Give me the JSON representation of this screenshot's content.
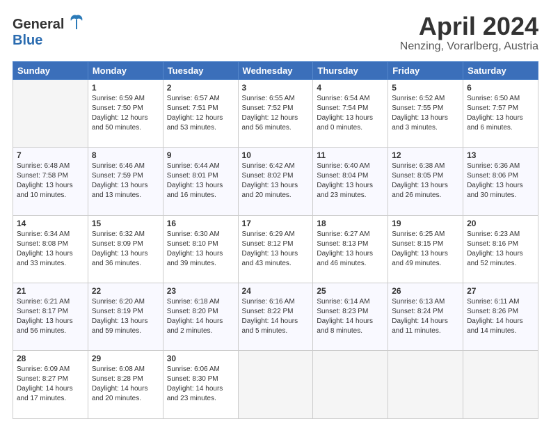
{
  "header": {
    "logo_line1": "General",
    "logo_line2": "Blue",
    "title": "April 2024",
    "subtitle": "Nenzing, Vorarlberg, Austria"
  },
  "weekdays": [
    "Sunday",
    "Monday",
    "Tuesday",
    "Wednesday",
    "Thursday",
    "Friday",
    "Saturday"
  ],
  "weeks": [
    [
      {
        "day": "",
        "info": ""
      },
      {
        "day": "1",
        "info": "Sunrise: 6:59 AM\nSunset: 7:50 PM\nDaylight: 12 hours\nand 50 minutes."
      },
      {
        "day": "2",
        "info": "Sunrise: 6:57 AM\nSunset: 7:51 PM\nDaylight: 12 hours\nand 53 minutes."
      },
      {
        "day": "3",
        "info": "Sunrise: 6:55 AM\nSunset: 7:52 PM\nDaylight: 12 hours\nand 56 minutes."
      },
      {
        "day": "4",
        "info": "Sunrise: 6:54 AM\nSunset: 7:54 PM\nDaylight: 13 hours\nand 0 minutes."
      },
      {
        "day": "5",
        "info": "Sunrise: 6:52 AM\nSunset: 7:55 PM\nDaylight: 13 hours\nand 3 minutes."
      },
      {
        "day": "6",
        "info": "Sunrise: 6:50 AM\nSunset: 7:57 PM\nDaylight: 13 hours\nand 6 minutes."
      }
    ],
    [
      {
        "day": "7",
        "info": "Sunrise: 6:48 AM\nSunset: 7:58 PM\nDaylight: 13 hours\nand 10 minutes."
      },
      {
        "day": "8",
        "info": "Sunrise: 6:46 AM\nSunset: 7:59 PM\nDaylight: 13 hours\nand 13 minutes."
      },
      {
        "day": "9",
        "info": "Sunrise: 6:44 AM\nSunset: 8:01 PM\nDaylight: 13 hours\nand 16 minutes."
      },
      {
        "day": "10",
        "info": "Sunrise: 6:42 AM\nSunset: 8:02 PM\nDaylight: 13 hours\nand 20 minutes."
      },
      {
        "day": "11",
        "info": "Sunrise: 6:40 AM\nSunset: 8:04 PM\nDaylight: 13 hours\nand 23 minutes."
      },
      {
        "day": "12",
        "info": "Sunrise: 6:38 AM\nSunset: 8:05 PM\nDaylight: 13 hours\nand 26 minutes."
      },
      {
        "day": "13",
        "info": "Sunrise: 6:36 AM\nSunset: 8:06 PM\nDaylight: 13 hours\nand 30 minutes."
      }
    ],
    [
      {
        "day": "14",
        "info": "Sunrise: 6:34 AM\nSunset: 8:08 PM\nDaylight: 13 hours\nand 33 minutes."
      },
      {
        "day": "15",
        "info": "Sunrise: 6:32 AM\nSunset: 8:09 PM\nDaylight: 13 hours\nand 36 minutes."
      },
      {
        "day": "16",
        "info": "Sunrise: 6:30 AM\nSunset: 8:10 PM\nDaylight: 13 hours\nand 39 minutes."
      },
      {
        "day": "17",
        "info": "Sunrise: 6:29 AM\nSunset: 8:12 PM\nDaylight: 13 hours\nand 43 minutes."
      },
      {
        "day": "18",
        "info": "Sunrise: 6:27 AM\nSunset: 8:13 PM\nDaylight: 13 hours\nand 46 minutes."
      },
      {
        "day": "19",
        "info": "Sunrise: 6:25 AM\nSunset: 8:15 PM\nDaylight: 13 hours\nand 49 minutes."
      },
      {
        "day": "20",
        "info": "Sunrise: 6:23 AM\nSunset: 8:16 PM\nDaylight: 13 hours\nand 52 minutes."
      }
    ],
    [
      {
        "day": "21",
        "info": "Sunrise: 6:21 AM\nSunset: 8:17 PM\nDaylight: 13 hours\nand 56 minutes."
      },
      {
        "day": "22",
        "info": "Sunrise: 6:20 AM\nSunset: 8:19 PM\nDaylight: 13 hours\nand 59 minutes."
      },
      {
        "day": "23",
        "info": "Sunrise: 6:18 AM\nSunset: 8:20 PM\nDaylight: 14 hours\nand 2 minutes."
      },
      {
        "day": "24",
        "info": "Sunrise: 6:16 AM\nSunset: 8:22 PM\nDaylight: 14 hours\nand 5 minutes."
      },
      {
        "day": "25",
        "info": "Sunrise: 6:14 AM\nSunset: 8:23 PM\nDaylight: 14 hours\nand 8 minutes."
      },
      {
        "day": "26",
        "info": "Sunrise: 6:13 AM\nSunset: 8:24 PM\nDaylight: 14 hours\nand 11 minutes."
      },
      {
        "day": "27",
        "info": "Sunrise: 6:11 AM\nSunset: 8:26 PM\nDaylight: 14 hours\nand 14 minutes."
      }
    ],
    [
      {
        "day": "28",
        "info": "Sunrise: 6:09 AM\nSunset: 8:27 PM\nDaylight: 14 hours\nand 17 minutes."
      },
      {
        "day": "29",
        "info": "Sunrise: 6:08 AM\nSunset: 8:28 PM\nDaylight: 14 hours\nand 20 minutes."
      },
      {
        "day": "30",
        "info": "Sunrise: 6:06 AM\nSunset: 8:30 PM\nDaylight: 14 hours\nand 23 minutes."
      },
      {
        "day": "",
        "info": ""
      },
      {
        "day": "",
        "info": ""
      },
      {
        "day": "",
        "info": ""
      },
      {
        "day": "",
        "info": ""
      }
    ]
  ]
}
